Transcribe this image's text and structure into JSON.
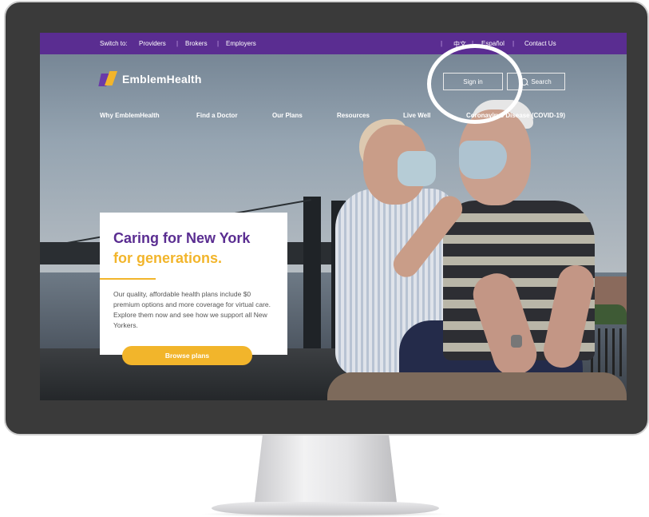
{
  "utility_bar": {
    "switch_to": "Switch to:",
    "links": [
      "Providers",
      "Brokers",
      "Employers"
    ],
    "right_links": [
      "中文",
      "Español",
      "Contact Us"
    ]
  },
  "header": {
    "logo_text": "EmblemHealth",
    "sign_in": "Sign in",
    "search": "Search"
  },
  "nav": {
    "items": [
      "Why EmblemHealth",
      "Find a Doctor",
      "Our Plans",
      "Resources",
      "Live Well",
      "Coronavirus Disease (COVID-19)"
    ]
  },
  "hero": {
    "title_line1": "Caring for New York",
    "title_line2": "for generations.",
    "body": "Our quality, affordable health plans include $0 premium options and more coverage for virtual care. Explore them now and see how we support all New Yorkers.",
    "cta": "Browse plans"
  },
  "colors": {
    "brand_purple": "#5a2d91",
    "brand_yellow": "#f2b52b"
  },
  "icons": [
    "emblemhealth-logo-icon",
    "search-icon"
  ]
}
